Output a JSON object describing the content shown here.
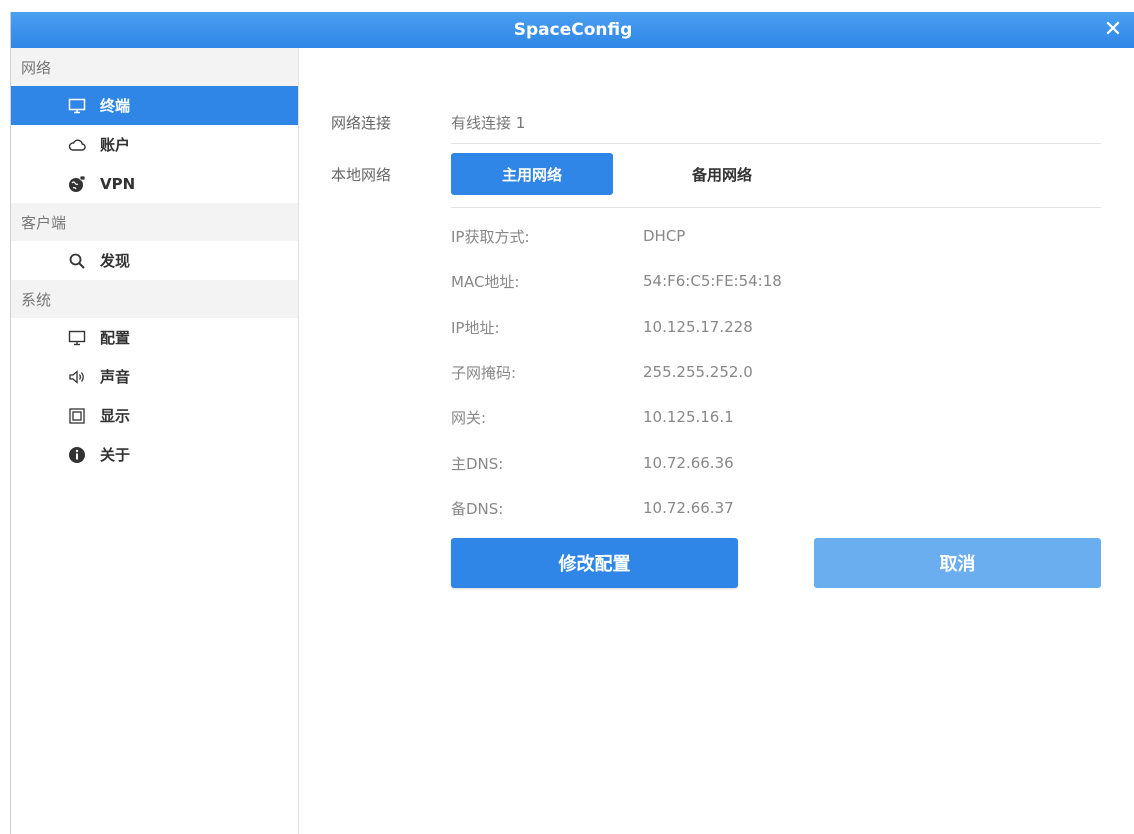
{
  "window": {
    "title": "SpaceConfig",
    "close_glyph": "✕"
  },
  "sidebar": {
    "groups": [
      {
        "label": "网络",
        "items": [
          {
            "label": "终端",
            "icon": "monitor-icon",
            "active": true
          },
          {
            "label": "账户",
            "icon": "cloud-icon"
          },
          {
            "label": "VPN",
            "icon": "globe-lock-icon"
          }
        ]
      },
      {
        "label": "客户端",
        "items": [
          {
            "label": "发现",
            "icon": "search-icon"
          }
        ]
      },
      {
        "label": "系统",
        "items": [
          {
            "label": "配置",
            "icon": "monitor-icon"
          },
          {
            "label": "声音",
            "icon": "speaker-icon"
          },
          {
            "label": "显示",
            "icon": "display-icon"
          },
          {
            "label": "关于",
            "icon": "info-icon"
          }
        ]
      }
    ]
  },
  "main": {
    "connection_label": "网络连接",
    "connection_value": "有线连接 1",
    "local_network_label": "本地网络",
    "tabs": [
      {
        "label": "主用网络",
        "active": true
      },
      {
        "label": "备用网络",
        "active": false
      }
    ],
    "info": [
      {
        "key": "IP获取方式:",
        "value": "DHCP"
      },
      {
        "key": "MAC地址:",
        "value": "54:F6:C5:FE:54:18"
      },
      {
        "key": "IP地址:",
        "value": "10.125.17.228"
      },
      {
        "key": "子网掩码:",
        "value": "255.255.252.0"
      },
      {
        "key": "网关:",
        "value": "10.125.16.1"
      },
      {
        "key": "主DNS:",
        "value": "10.72.66.36"
      },
      {
        "key": "备DNS:",
        "value": "10.72.66.37"
      }
    ],
    "modify_button": "修改配置",
    "cancel_button": "取消"
  },
  "colors": {
    "accent": "#2f86e6",
    "accent_light": "#6aaef0",
    "group_bg": "#f3f3f3"
  }
}
